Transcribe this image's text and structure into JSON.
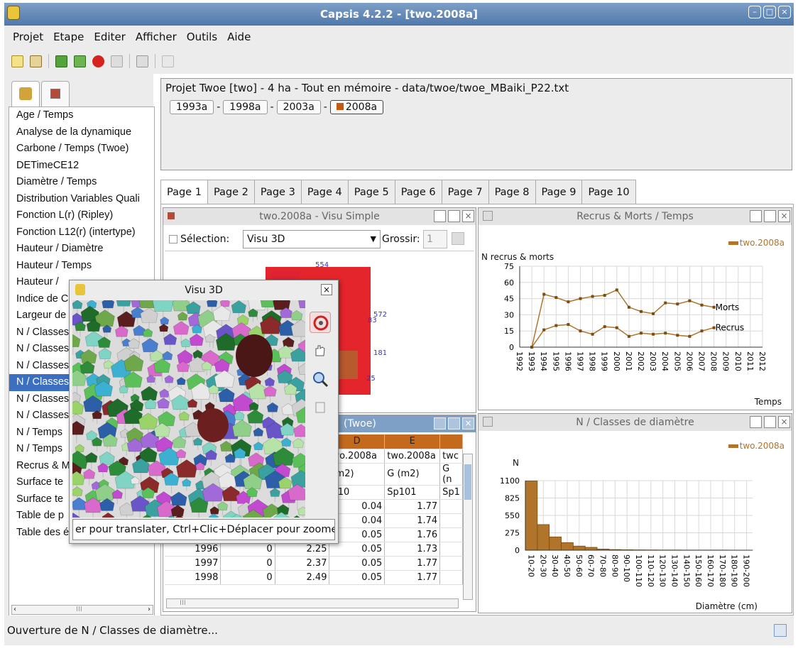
{
  "app": {
    "title": "Capsis 4.2.2 - [two.2008a]"
  },
  "menu": [
    "Projet",
    "Etape",
    "Editer",
    "Afficher",
    "Outils",
    "Aide"
  ],
  "tree": {
    "items": [
      "Age / Temps",
      "Analyse de la dynamique",
      "Carbone / Temps (Twoe)",
      "DETimeCE12",
      "Diamètre / Temps",
      "Distribution Variables Quali",
      "Fonction L(r) (Ripley)",
      "Fonction L12(r) (intertype)",
      "Hauteur / Diamètre",
      "Hauteur / Temps",
      "Hauteur / ",
      "Indice de C",
      "Largeur de",
      "N / Classes",
      "N / Classes",
      "N / Classes",
      "N / Classes",
      "N / Classes",
      "N / Classes",
      "N / Temps",
      "N / Temps",
      "Recrus & M",
      "Surface te",
      "Surface te",
      "Table de p",
      "Table des éclaircies"
    ],
    "hscroll": "III"
  },
  "project": {
    "title": "Projet Twoe [two] - 4 ha - Tout en mémoire - data/twoe/twoe_MBaiki_P22.txt",
    "steps": [
      "1993a",
      "1998a",
      "2003a",
      "2008a"
    ]
  },
  "pages": [
    "Page 1",
    "Page 2",
    "Page 3",
    "Page 4",
    "Page 5",
    "Page 6",
    "Page 7",
    "Page 8",
    "Page 9",
    "Page 10"
  ],
  "visu_simple": {
    "title": "two.2008a - Visu Simple",
    "selection_label": "Sélection:",
    "selection_value": "Visu 3D",
    "grossir_label": "Grossir:",
    "grossir_value": "1",
    "labels": [
      "554",
      "572",
      "83",
      "181",
      "25"
    ]
  },
  "recrus_chart": {
    "title": "Recrus & Morts / Temps",
    "legend": "two.2008a",
    "ylabel": "N recrus & morts",
    "xlabel": "Temps",
    "series_labels": [
      "Morts",
      "Recrus"
    ]
  },
  "classes_chart": {
    "title": "N / Classes de diamètre",
    "legend": "two.2008a",
    "ylabel": "N",
    "xlabel": "Diamètre (cm)"
  },
  "table": {
    "title": "(Twoe)",
    "col_letters": [
      "D",
      "E",
      ""
    ],
    "header1": [
      "wo.2008a",
      "two.2008a",
      "twc"
    ],
    "header2": [
      "(m2)",
      "G (m2)",
      "G (n"
    ],
    "header3": [
      "p10",
      "Sp101",
      "Sp1"
    ],
    "rows": [
      [
        "",
        "",
        "",
        "0.04",
        "1.77"
      ],
      [
        "",
        "",
        "",
        "0.04",
        "1.74"
      ],
      [
        "",
        "",
        "",
        "0.05",
        "1.76"
      ],
      [
        "1996",
        "0",
        "2.25",
        "0.05",
        "1.73"
      ],
      [
        "1997",
        "0",
        "2.37",
        "0.05",
        "1.77"
      ],
      [
        "1998",
        "0",
        "2.49",
        "0.05",
        "1.77"
      ]
    ],
    "hscroll": "III"
  },
  "visu3d": {
    "title": "Visu 3D",
    "tooltip": "er pour translater, Ctrl+Clic+Déplacer pour zoomer"
  },
  "status": "Ouverture de N / Classes de diamètre...",
  "chart_data": [
    {
      "type": "line",
      "title": "Recrus & Morts / Temps",
      "xlabel": "Temps",
      "ylabel": "N recrus & morts",
      "x": [
        1993,
        1994,
        1995,
        1996,
        1997,
        1998,
        1999,
        2000,
        2001,
        2002,
        2003,
        2004,
        2005,
        2006,
        2007,
        2008
      ],
      "x_ticks": [
        1992,
        1993,
        1994,
        1995,
        1996,
        1997,
        1998,
        1999,
        2000,
        2001,
        2002,
        2003,
        2004,
        2005,
        2006,
        2007,
        2008,
        2009,
        2010,
        2011,
        2012
      ],
      "ylim": [
        0,
        75
      ],
      "y_ticks": [
        0,
        15,
        30,
        45,
        60,
        75
      ],
      "series": [
        {
          "name": "Morts",
          "values": [
            0,
            49,
            46,
            42,
            45,
            47,
            48,
            53,
            37,
            33,
            31,
            41,
            40,
            43,
            39,
            37
          ]
        },
        {
          "name": "Recrus",
          "values": [
            0,
            16,
            20,
            21,
            15,
            12,
            19,
            18,
            10,
            13,
            12,
            13,
            11,
            10,
            15,
            18
          ]
        }
      ],
      "legend": "two.2008a",
      "grid": true,
      "color": "#b0742a"
    },
    {
      "type": "bar",
      "title": "N / Classes de diamètre",
      "xlabel": "Diamètre (cm)",
      "ylabel": "N",
      "categories": [
        "10-20",
        "20-30",
        "30-40",
        "40-50",
        "50-60",
        "60-70",
        "70-80",
        "80-90",
        "90-100",
        "100-110",
        "110-120",
        "120-130",
        "130-140",
        "140-150",
        "150-160",
        "160-170",
        "170-180",
        "180-190",
        "190-200"
      ],
      "values": [
        1095,
        405,
        210,
        120,
        65,
        45,
        18,
        10,
        7,
        5,
        4,
        3,
        3,
        2,
        2,
        2,
        2,
        1,
        1
      ],
      "ylim": [
        0,
        1100
      ],
      "y_ticks": [
        0,
        275,
        550,
        825,
        1100
      ],
      "legend": "two.2008a",
      "grid": true,
      "color": "#b0742a"
    }
  ]
}
